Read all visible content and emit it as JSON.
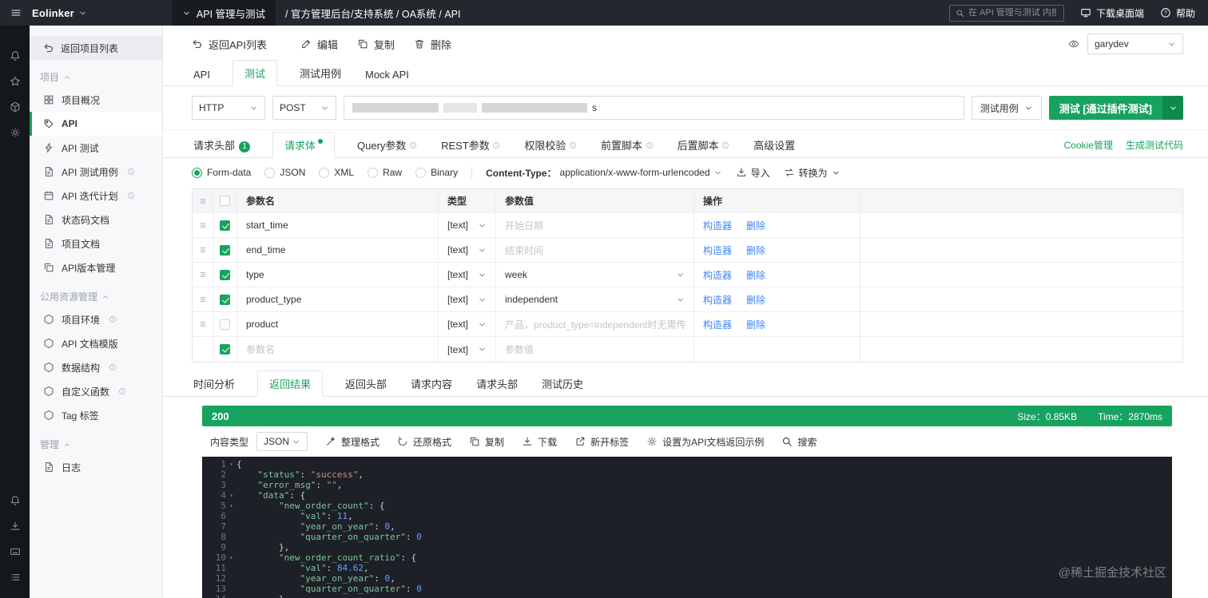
{
  "topbar": {
    "logo": "Eolinker",
    "product_tab": "API 管理与测试",
    "breadcrumb": "/ 官方管理后台/支持系统 / OA系统 / API",
    "search_placeholder": "在 API 管理与测试 内搜索",
    "download_label": "下载桌面端",
    "help_label": "帮助"
  },
  "sidebar": {
    "back_label": "返回项目列表",
    "sections": [
      {
        "title": "项目",
        "items": [
          {
            "label": "项目概况"
          },
          {
            "label": "API",
            "active": true
          },
          {
            "label": "API 测试"
          },
          {
            "label": "API 测试用例",
            "info": true
          },
          {
            "label": "API 迭代计划",
            "info": true
          },
          {
            "label": "状态码文档"
          },
          {
            "label": "项目文档"
          },
          {
            "label": "API版本管理"
          }
        ]
      },
      {
        "title": "公用资源管理",
        "items": [
          {
            "label": "项目环境",
            "info": true
          },
          {
            "label": "API 文档模版"
          },
          {
            "label": "数据结构",
            "info": true
          },
          {
            "label": "自定义函数",
            "info": true
          },
          {
            "label": "Tag 标签"
          }
        ]
      },
      {
        "title": "管理",
        "items": [
          {
            "label": "日志"
          }
        ]
      }
    ]
  },
  "toolbar": {
    "back_label": "返回API列表",
    "edit_label": "编辑",
    "copy_label": "复制",
    "delete_label": "删除",
    "user": "garydev"
  },
  "tabs": {
    "api": "API",
    "test": "测试",
    "cases": "测试用例",
    "mock": "Mock API",
    "active": "测试"
  },
  "request": {
    "protocol": "HTTP",
    "method": "POST",
    "url_visible_suffix": "s",
    "case_button": "测试用例",
    "test_button": "测试 [通过插件测试]"
  },
  "request_tabs": {
    "items": [
      {
        "label": "请求头部",
        "badge": "1"
      },
      {
        "label": "请求体"
      },
      {
        "label": "Query参数"
      },
      {
        "label": "REST参数"
      },
      {
        "label": "权限校验"
      },
      {
        "label": "前置脚本"
      },
      {
        "label": "后置脚本"
      },
      {
        "label": "高级设置"
      }
    ],
    "active": "请求体",
    "links": [
      "Cookie管理",
      "生成测试代码"
    ]
  },
  "body_options": {
    "radios": [
      "Form-data",
      "JSON",
      "XML",
      "Raw",
      "Binary"
    ],
    "selected": "Form-data",
    "content_type_label": "Content-Type：",
    "content_type": "application/x-www-form-urlencoded",
    "import_label": "导入",
    "convert_label": "转换为"
  },
  "params": {
    "headers": {
      "name": "参数名",
      "type": "类型",
      "value": "参数值",
      "action": "操作"
    },
    "type_value": "[text]",
    "builder_label": "构造器",
    "delete_label": "删除",
    "rows": [
      {
        "name": "start_time",
        "checked": true,
        "placeholder": "开始日期",
        "value": ""
      },
      {
        "name": "end_time",
        "checked": true,
        "placeholder": "结束时间",
        "value": ""
      },
      {
        "name": "type",
        "checked": true,
        "value": "week",
        "select": true
      },
      {
        "name": "product_type",
        "checked": true,
        "value": "independent",
        "select": true
      },
      {
        "name": "product",
        "checked": false,
        "placeholder": "产品，product_type=independent时无需传",
        "value": ""
      }
    ],
    "new_row": {
      "name_placeholder": "参数名",
      "value_placeholder": "参数值",
      "checked": true
    }
  },
  "result": {
    "tabs": [
      "时间分析",
      "返回结果",
      "返回头部",
      "请求内容",
      "请求头部",
      "测试历史"
    ],
    "active_tab": "返回结果",
    "status_code": "200",
    "size_label": "Size：0.85KB",
    "time_label": "Time：2870ms",
    "content_type_label": "内容类型",
    "content_type": "JSON",
    "actions": [
      "整理格式",
      "还原格式",
      "复制",
      "下载",
      "新开标签",
      "设置为API文档返回示例",
      "搜索"
    ],
    "code_lines": [
      "{",
      "    \"status\": \"success\",",
      "    \"error_msg\": \"\",",
      "    \"data\": {",
      "        \"new_order_count\": {",
      "            \"val\": 11,",
      "            \"year_on_year\": 0,",
      "            \"quarter_on_quarter\": 0",
      "        },",
      "        \"new_order_count_ratio\": {",
      "            \"val\": 84.62,",
      "            \"year_on_year\": 0,",
      "            \"quarter_on_quarter\": 0",
      "        },"
    ]
  },
  "watermark": "@稀土掘金技术社区"
}
